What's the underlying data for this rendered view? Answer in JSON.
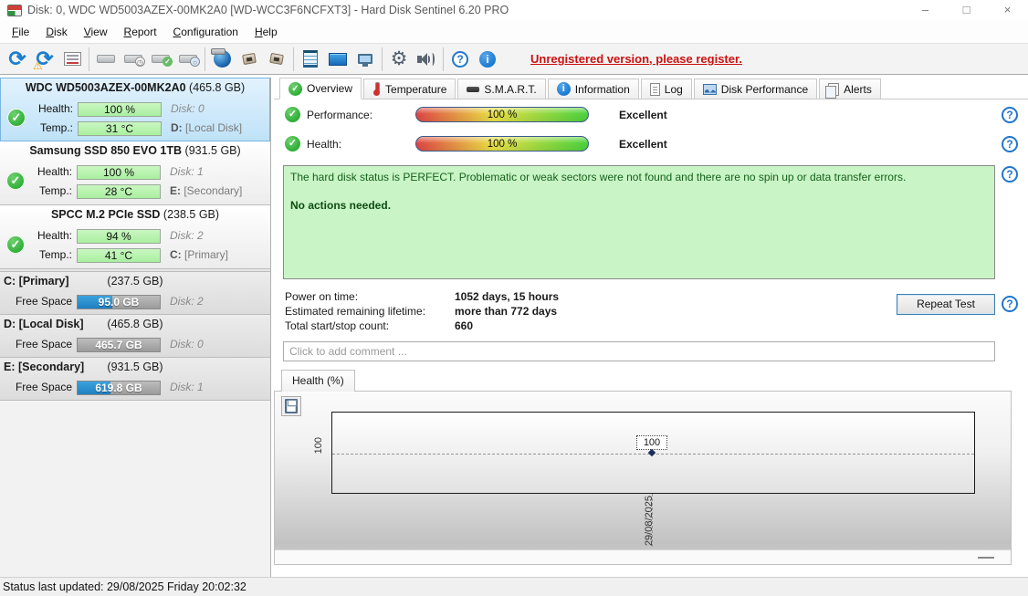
{
  "window": {
    "title": "Disk: 0, WDC WD5003AZEX-00MK2A0 [WD-WCC3F6NCFXT3]  -  Hard Disk Sentinel 6.20 PRO",
    "controls": {
      "minimize": "–",
      "maximize": "□",
      "close": "×"
    }
  },
  "menu": {
    "items": [
      "File",
      "Disk",
      "View",
      "Report",
      "Configuration",
      "Help"
    ]
  },
  "toolbar": {
    "icons": [
      "refresh",
      "refresh-warning",
      "report",
      "disk-offline",
      "disk-clock",
      "disk-check",
      "disk-search",
      "network-disk",
      "connector-1",
      "connector-2",
      "notes",
      "mail",
      "network-computer",
      "settings",
      "sound",
      "help",
      "info"
    ],
    "register_notice": "Unregistered version, please register."
  },
  "labels": {
    "health": "Health:",
    "temp": "Temp.:",
    "free_space": "Free Space"
  },
  "sidebar": {
    "disks": [
      {
        "name": "WDC WD5003AZEX-00MK2A0",
        "size": "(465.8 GB)",
        "health": "100 %",
        "disk_no": "Disk: 0",
        "temp": "31 °C",
        "drive_letter": "D:",
        "drive_name": "[Local Disk]"
      },
      {
        "name": "Samsung SSD 850 EVO 1TB",
        "size": "(931.5 GB)",
        "health": "100 %",
        "disk_no": "Disk: 1",
        "temp": "28 °C",
        "drive_letter": "E:",
        "drive_name": "[Secondary]"
      },
      {
        "name": "SPCC M.2 PCIe SSD",
        "size": "(238.5 GB)",
        "health": "94 %",
        "disk_no": "Disk: 2",
        "temp": "41 °C",
        "drive_letter": "C:",
        "drive_name": "[Primary]"
      }
    ],
    "partitions": [
      {
        "name": "C: [Primary]",
        "size": "(237.5 GB)",
        "free": "95.0 GB",
        "disk_no": "Disk: 2",
        "fill": 42
      },
      {
        "name": "D: [Local Disk]",
        "size": "(465.8 GB)",
        "free": "465.7 GB",
        "disk_no": "Disk: 0",
        "fill": 0
      },
      {
        "name": "E: [Secondary]",
        "size": "(931.5 GB)",
        "free": "619.8 GB",
        "disk_no": "Disk: 1",
        "fill": 40
      }
    ]
  },
  "tabs": [
    {
      "label": "Overview"
    },
    {
      "label": "Temperature"
    },
    {
      "label": "S.M.A.R.T."
    },
    {
      "label": "Information"
    },
    {
      "label": "Log"
    },
    {
      "label": "Disk Performance"
    },
    {
      "label": "Alerts"
    }
  ],
  "overview": {
    "performance_label": "Performance:",
    "performance_value": "100 %",
    "performance_rating": "Excellent",
    "health_label": "Health:",
    "health_value": "100 %",
    "health_rating": "Excellent",
    "status_text": "The hard disk status is PERFECT. Problematic or weak sectors were not found and there are no spin up or data transfer errors.",
    "status_action": "No actions needed.",
    "info_rows": [
      {
        "label": "Power on time:",
        "value": "1052 days, 15 hours"
      },
      {
        "label": "Estimated remaining lifetime:",
        "value": "more than 772 days"
      },
      {
        "label": "Total start/stop count:",
        "value": "660"
      }
    ],
    "repeat_test_label": "Repeat Test",
    "comment_placeholder": "Click to add comment ..."
  },
  "chart": {
    "tab_label": "Health (%)",
    "y_tick": "100",
    "x_tick": "29/08/2025",
    "point_label": "100"
  },
  "chart_data": {
    "type": "line",
    "title": "Health (%)",
    "x": [
      "29/08/2025"
    ],
    "series": [
      {
        "name": "Health",
        "values": [
          100
        ]
      }
    ],
    "ylabel": "Health (%)",
    "y_ticks": [
      100
    ],
    "grid": true,
    "legend_position": "none"
  },
  "statusbar": {
    "text": "Status last updated: 29/08/2025 Friday 20:02:32"
  },
  "accent_colors": {
    "selection_blue": "#bfe2f8",
    "health_green": "#a9efa0",
    "free_blue": "#2e96d6",
    "status_green_bg": "#c9f4c5",
    "register_red": "#cc1111"
  }
}
